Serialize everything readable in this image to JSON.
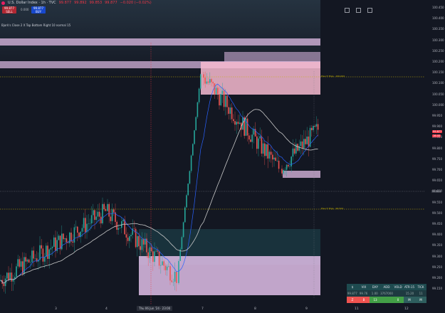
{
  "header": {
    "title": "U.S. Dollar Index · 1h · TVC",
    "ohlc": [
      "99.877",
      "99.892",
      "99.853",
      "99.877",
      "−0.020 (−0.02%)"
    ],
    "sell_price": "99.877",
    "sell_label": "SELL",
    "spread": "0.000",
    "buy_price": "99.877",
    "buy_label": "BUY"
  },
  "indicator_label": "Bjork's Close 2 X Top Bottom Right 10 normal 15",
  "price_axis": {
    "labels": [
      "100.450",
      "100.400",
      "100.350",
      "100.300",
      "100.250",
      "100.200",
      "100.150",
      "100.100",
      "100.050",
      "100.000",
      "99.950",
      "99.900",
      "99.850",
      "99.800",
      "99.750",
      "99.700",
      "99.650",
      "99.600",
      "99.550",
      "99.500",
      "99.450",
      "99.400",
      "99.350",
      "99.300",
      "99.250",
      "99.200",
      "99.150"
    ],
    "current_price": "99.877",
    "current_time": "16:40",
    "level_price": "99.624"
  },
  "time_axis": {
    "labels": [
      "3",
      "4",
      "7",
      "8",
      "9",
      "10",
      "11",
      "12"
    ],
    "crosshair_label": "Thu 06 Jun '24 · 23:00"
  },
  "levels": {
    "prev_day_high": "Prev H Hrgs · 100.0XX",
    "prev_day_low": "Prev H Hrgs · 99.5XX"
  },
  "breadth_table": {
    "headers": [
      "$",
      "VIX",
      "DXY",
      "ADD",
      "VOLD",
      "ATR-15",
      "TICK"
    ],
    "values": [
      "99.877",
      "99.76",
      "1.00",
      "3767000",
      "",
      "15.20",
      "11"
    ],
    "cells": [
      "Z",
      "B",
      "13",
      "",
      "0",
      "M",
      "M"
    ]
  },
  "colors": {
    "background": "#131722",
    "bull": "#26a69a",
    "bear": "#ef5350",
    "zone": "#e1bee7",
    "zone_bright": "#f8bbd0",
    "ma": "#c8c8c8",
    "ma_blue": "#2962ff"
  },
  "chart_data": {
    "type": "candlestick",
    "x_labels": [
      "3",
      "4",
      "7",
      "8",
      "9",
      "10",
      "11",
      "12"
    ],
    "ylim": [
      99.15,
      100.45
    ],
    "segments": [
      {
        "from_day": "3",
        "start": 99.18,
        "end": 99.5
      },
      {
        "from_day": "4",
        "start": 99.5,
        "end": 99.2
      },
      {
        "from_day": "6",
        "start": 99.2,
        "end": 100.13
      },
      {
        "from_day": "8",
        "start": 100.13,
        "end": 99.7
      },
      {
        "from_day": "10",
        "start": 99.7,
        "end": 99.88
      }
    ]
  }
}
